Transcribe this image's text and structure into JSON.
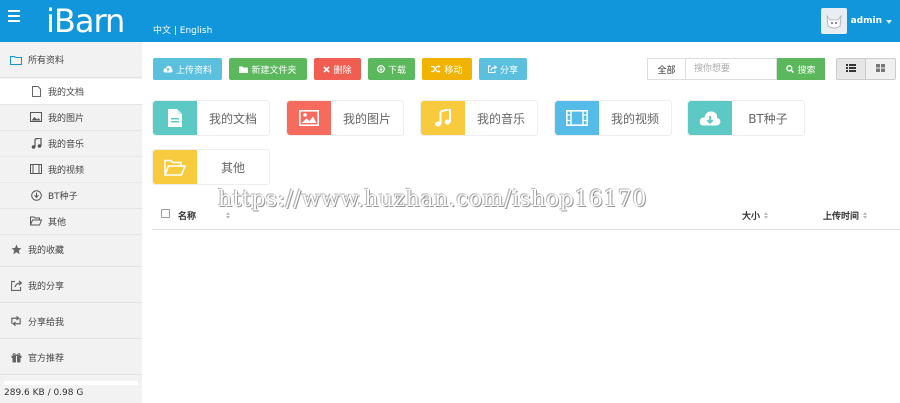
{
  "header": {
    "logo_text": "iBarn",
    "lang_zh": "中文",
    "lang_sep": " | ",
    "lang_en": "English",
    "user_name": "admin",
    "bg_color": "#1296db"
  },
  "sidebar": {
    "all_files": "所有资料",
    "sub_items": [
      {
        "label": "我的文档",
        "icon": "document-icon"
      },
      {
        "label": "我的图片",
        "icon": "image-icon"
      },
      {
        "label": "我的音乐",
        "icon": "music-icon"
      },
      {
        "label": "我的视频",
        "icon": "film-icon"
      },
      {
        "label": "BT种子",
        "icon": "download-icon"
      },
      {
        "label": "其他",
        "icon": "folder-open-icon"
      }
    ],
    "main_items": [
      {
        "label": "我的收藏",
        "icon": "star-icon"
      },
      {
        "label": "我的分享",
        "icon": "share-icon"
      },
      {
        "label": "分享给我",
        "icon": "retweet-icon"
      },
      {
        "label": "官方推荐",
        "icon": "gift-icon"
      }
    ],
    "storage": "289.6 KB / 0.98 G"
  },
  "toolbar": {
    "upload": "上传资料",
    "new_folder": "新建文件夹",
    "delete": "删除",
    "download": "下载",
    "move": "移动",
    "share": "分享",
    "search_scope": "全部",
    "search_placeholder": "搜你想要",
    "search_button": "搜索"
  },
  "categories": [
    {
      "label": "我的文档",
      "color": "#5cc9c4",
      "icon": "document-icon"
    },
    {
      "label": "我的图片",
      "color": "#f56c5f",
      "icon": "image-icon"
    },
    {
      "label": "我的音乐",
      "color": "#f7cb3d",
      "icon": "music-icon"
    },
    {
      "label": "我的视频",
      "color": "#55bce8",
      "icon": "film-icon"
    },
    {
      "label": "BT种子",
      "color": "#5cc9c4",
      "icon": "cloud-download-icon"
    },
    {
      "label": "其他",
      "color": "#f7cb3d",
      "icon": "folder-open-icon"
    }
  ],
  "table": {
    "col_name": "名称",
    "col_size": "大小",
    "col_time": "上传时间"
  },
  "watermark": "https://www.huzhan.com/ishop16170"
}
